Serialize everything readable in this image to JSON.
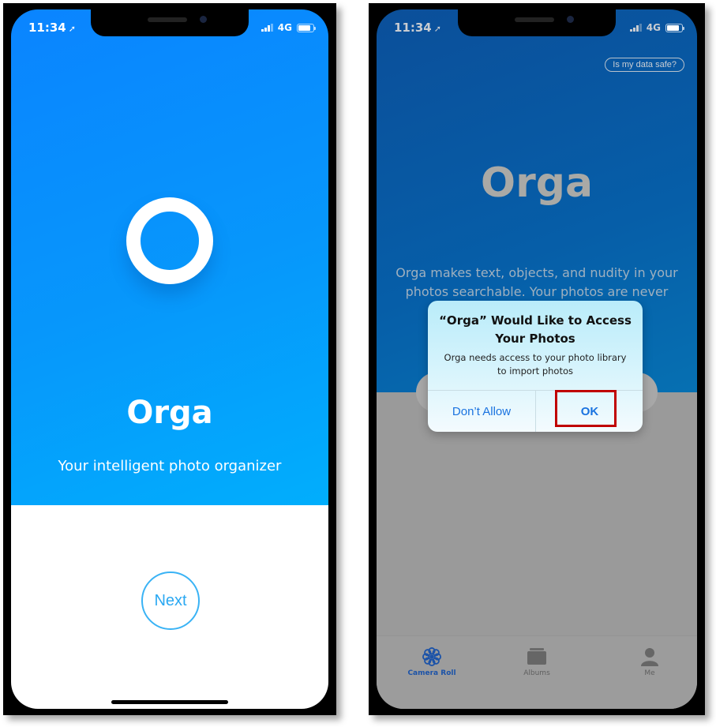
{
  "status_bar": {
    "time": "11:34",
    "location_icon": "location-arrow-icon",
    "network": "4G",
    "signal_icon": "signal-bars-icon",
    "battery_icon": "battery-icon"
  },
  "left_screen": {
    "logo_icon": "ring-icon",
    "title": "Orga",
    "subtitle": "Your intelligent photo organizer",
    "next_label": "Next",
    "colors": {
      "gradient_start": "#0a84ff",
      "gradient_end": "#01aefc",
      "button_accent": "#2aa8f2"
    }
  },
  "right_screen": {
    "safety_link": "Is my data safe?",
    "title": "Orga",
    "description": "Orga makes text, objects, and nudity in your photos searchable. Your photos are never",
    "alert": {
      "title": "“Orga” Would Like to Access Your Photos",
      "message": "Orga needs access to your photo library to import photos",
      "dont_allow_label": "Don’t Allow",
      "ok_label": "OK",
      "highlight_color": "#c00000"
    },
    "tabs": [
      {
        "label": "Camera Roll",
        "icon": "camera-roll-flower-icon",
        "active": true
      },
      {
        "label": "Albums",
        "icon": "albums-stack-icon",
        "active": false
      },
      {
        "label": "Me",
        "icon": "person-icon",
        "active": false
      }
    ]
  }
}
